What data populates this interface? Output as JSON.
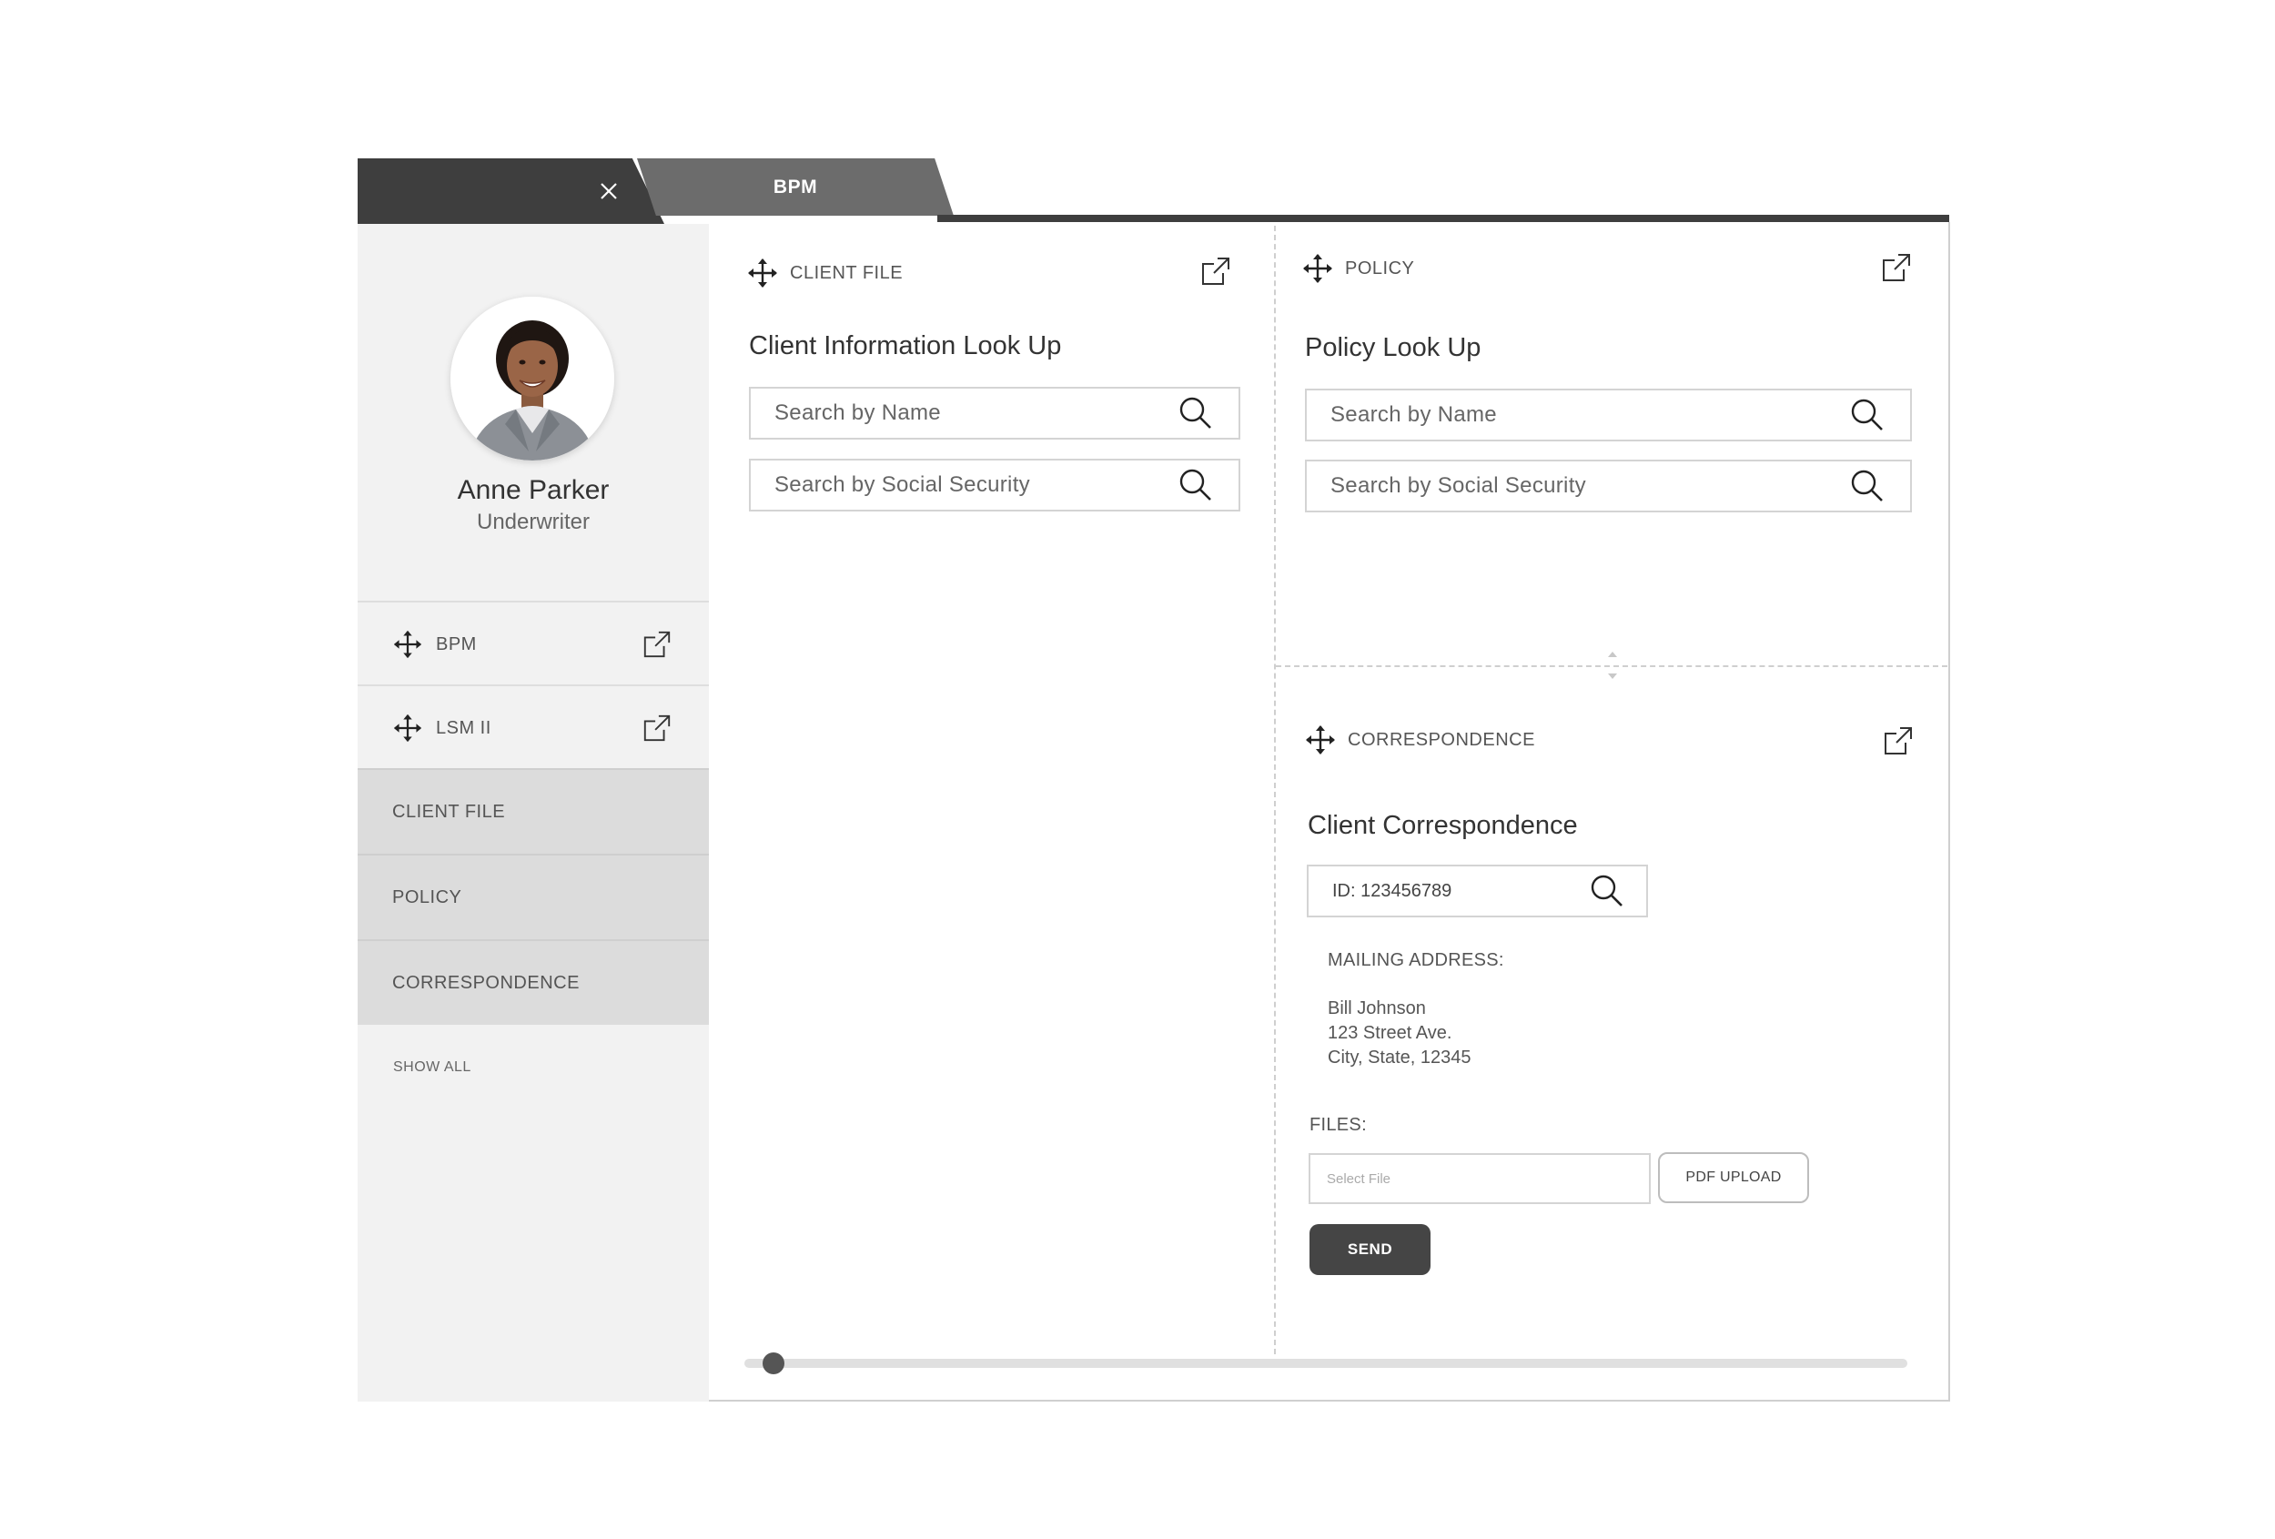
{
  "tabs": {
    "active_label": "BPM"
  },
  "user": {
    "name": "Anne Parker",
    "role": "Underwriter"
  },
  "sidebar": {
    "widgets": [
      {
        "label": "BPM"
      },
      {
        "label": "LSM II"
      }
    ],
    "sections": [
      {
        "label": "CLIENT FILE"
      },
      {
        "label": "POLICY"
      },
      {
        "label": "CORRESPONDENCE"
      }
    ],
    "show_all": "SHOW ALL"
  },
  "client_file": {
    "header": "CLIENT FILE",
    "title": "Client Information Look Up",
    "search_name_placeholder": "Search by Name",
    "search_ssn_placeholder": "Search by Social Security"
  },
  "policy": {
    "header": "POLICY",
    "title": "Policy Look Up",
    "search_name_placeholder": "Search by Name",
    "search_ssn_placeholder": "Search by Social Security"
  },
  "correspondence": {
    "header": "CORRESPONDENCE",
    "title": "Client Correspondence",
    "id_value": "ID: 123456789",
    "mailing_label": "MAILING ADDRESS:",
    "address": [
      "Bill Johnson",
      "123 Street Ave.",
      "City, State, 12345"
    ],
    "files_label": "FILES:",
    "file_placeholder": "Select File",
    "pdf_upload": "PDF UPLOAD",
    "send": "SEND"
  },
  "scroll": {
    "position": 0.0
  }
}
